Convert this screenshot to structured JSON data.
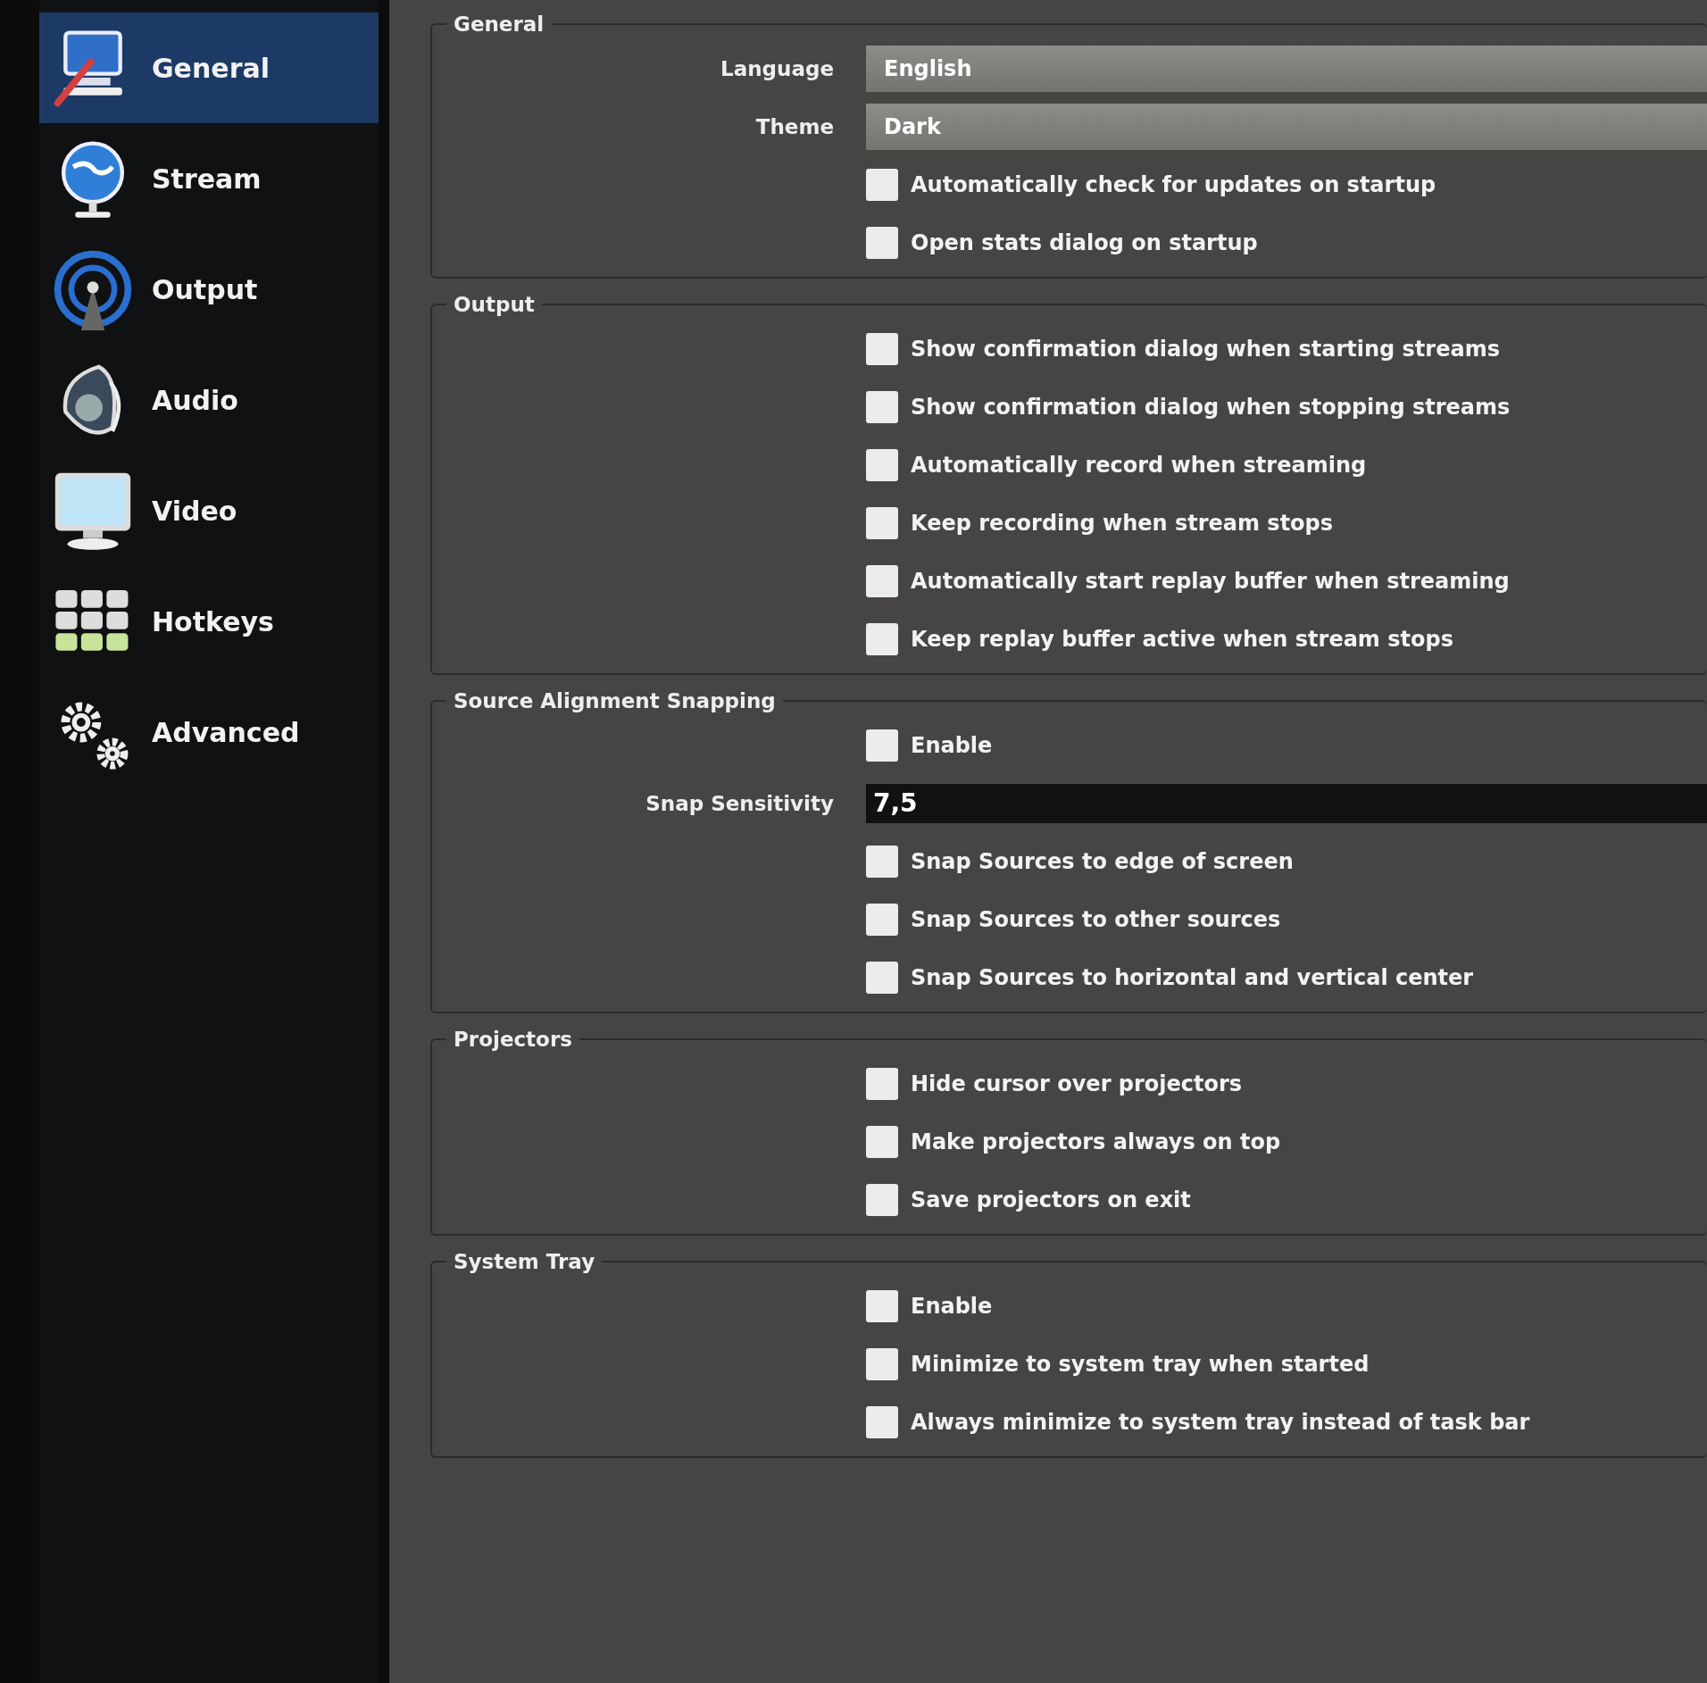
{
  "sidebar": {
    "items": [
      {
        "label": "General",
        "selected": true
      },
      {
        "label": "Stream",
        "selected": false
      },
      {
        "label": "Output",
        "selected": false
      },
      {
        "label": "Audio",
        "selected": false
      },
      {
        "label": "Video",
        "selected": false
      },
      {
        "label": "Hotkeys",
        "selected": false
      },
      {
        "label": "Advanced",
        "selected": false
      }
    ]
  },
  "groups": [
    {
      "title": "General",
      "rows": [
        {
          "kind": "select",
          "label": "Language",
          "value": "English"
        },
        {
          "kind": "select",
          "label": "Theme",
          "value": "Dark"
        },
        {
          "kind": "checkbox",
          "label": "Automatically check for updates on startup",
          "checked": false
        },
        {
          "kind": "checkbox",
          "label": "Open stats dialog on startup",
          "checked": false
        }
      ]
    },
    {
      "title": "Output",
      "rows": [
        {
          "kind": "checkbox",
          "label": "Show confirmation dialog when starting streams",
          "checked": false
        },
        {
          "kind": "checkbox",
          "label": "Show confirmation dialog when stopping streams",
          "checked": false
        },
        {
          "kind": "checkbox",
          "label": "Automatically record when streaming",
          "checked": false
        },
        {
          "kind": "checkbox",
          "label": "Keep recording when stream stops",
          "checked": false
        },
        {
          "kind": "checkbox",
          "label": "Automatically start replay buffer when streaming",
          "checked": false
        },
        {
          "kind": "checkbox",
          "label": "Keep replay buffer active when stream stops",
          "checked": false
        }
      ]
    },
    {
      "title": "Source Alignment Snapping",
      "rows": [
        {
          "kind": "checkbox",
          "label": "Enable",
          "checked": false
        },
        {
          "kind": "spin",
          "label": "Snap Sensitivity",
          "value": "7,5"
        },
        {
          "kind": "checkbox",
          "label": "Snap Sources to edge of screen",
          "checked": false
        },
        {
          "kind": "checkbox",
          "label": "Snap Sources to other sources",
          "checked": false
        },
        {
          "kind": "checkbox",
          "label": "Snap Sources to horizontal and vertical center",
          "checked": false
        }
      ]
    },
    {
      "title": "Projectors",
      "rows": [
        {
          "kind": "checkbox",
          "label": "Hide cursor over projectors",
          "checked": false
        },
        {
          "kind": "checkbox",
          "label": "Make projectors always on top",
          "checked": false
        },
        {
          "kind": "checkbox",
          "label": "Save projectors on exit",
          "checked": false
        }
      ]
    },
    {
      "title": "System Tray",
      "rows": [
        {
          "kind": "checkbox",
          "label": "Enable",
          "checked": false
        },
        {
          "kind": "checkbox",
          "label": "Minimize to system tray when started",
          "checked": false
        },
        {
          "kind": "checkbox",
          "label": "Always minimize to system tray instead of task bar",
          "checked": false
        }
      ]
    }
  ]
}
